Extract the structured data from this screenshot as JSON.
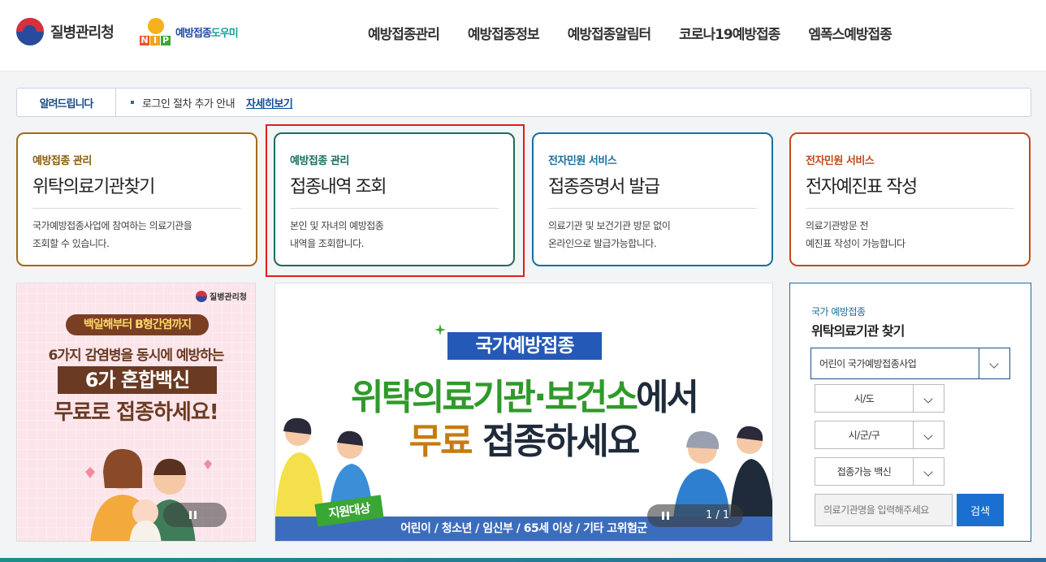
{
  "header": {
    "kdca_logo_text": "질병관리청",
    "nip_letters": [
      "N",
      "I",
      "P"
    ],
    "nip_text_1": "예방접종",
    "nip_text_2": "도우미",
    "nav": [
      "예방접종관리",
      "예방접종정보",
      "예방접종알림터",
      "코로나19예방접종",
      "엠폭스예방접종"
    ]
  },
  "notice": {
    "label": "알려드립니다",
    "text": "로그인 절차 추가 안내",
    "link": "자세히보기"
  },
  "cards": [
    {
      "category": "예방접종 관리",
      "title": "위탁의료기관찾기",
      "desc1": "국가예방접종사업에 참여하는 의료기관을",
      "desc2": "조회할 수 있습니다."
    },
    {
      "category": "예방접종 관리",
      "title": "접종내역 조회",
      "desc1": "본인 및 자녀의 예방접종",
      "desc2": "내역을 조회합니다."
    },
    {
      "category": "전자민원 서비스",
      "title": "접종증명서 발급",
      "desc1": "의료기관 및 보건기관 방문 없이",
      "desc2": "온라인으로 발급가능합니다."
    },
    {
      "category": "전자민원 서비스",
      "title": "전자예진표 작성",
      "desc1": "의료기관방문 전",
      "desc2": "예진표 작성이 가능합니다"
    }
  ],
  "left_banner": {
    "logo": "질병관리청",
    "pill": "백일해부터 B형간염까지",
    "line2": "6가지 감염병을 동시에 예방하는",
    "line3": "6가 혼합백신",
    "line4": "무료로 접종하세요!"
  },
  "main_banner": {
    "tag": "국가예방접종",
    "headline1_green": "위탁의료기관·보건소",
    "headline1_dark": "에서",
    "headline2_orange": "무료",
    "headline2_dark": " 접종하세요",
    "badge": "지원대상",
    "targets": "어린이 / 청소년 / 임신부 / 65세 이상 / 기타 고위험군",
    "page": "1 / 1"
  },
  "finder": {
    "category": "국가 예방접종",
    "title": "위탁의료기관 찾기",
    "program_select": "어린이 국가예방접종사업",
    "sido_select": "시/도",
    "sigungu_select": "시/군/구",
    "vaccine_select": "접종가능 백신",
    "search_placeholder": "의료기관명을 입력해주세요",
    "search_button": "검색"
  },
  "colors": {
    "card1": "#a36a16",
    "card2": "#1b6e5e",
    "card3": "#1b6f9e",
    "card4": "#c2491b",
    "highlight": "#e01e1e",
    "search_button": "#1a6fd1"
  }
}
